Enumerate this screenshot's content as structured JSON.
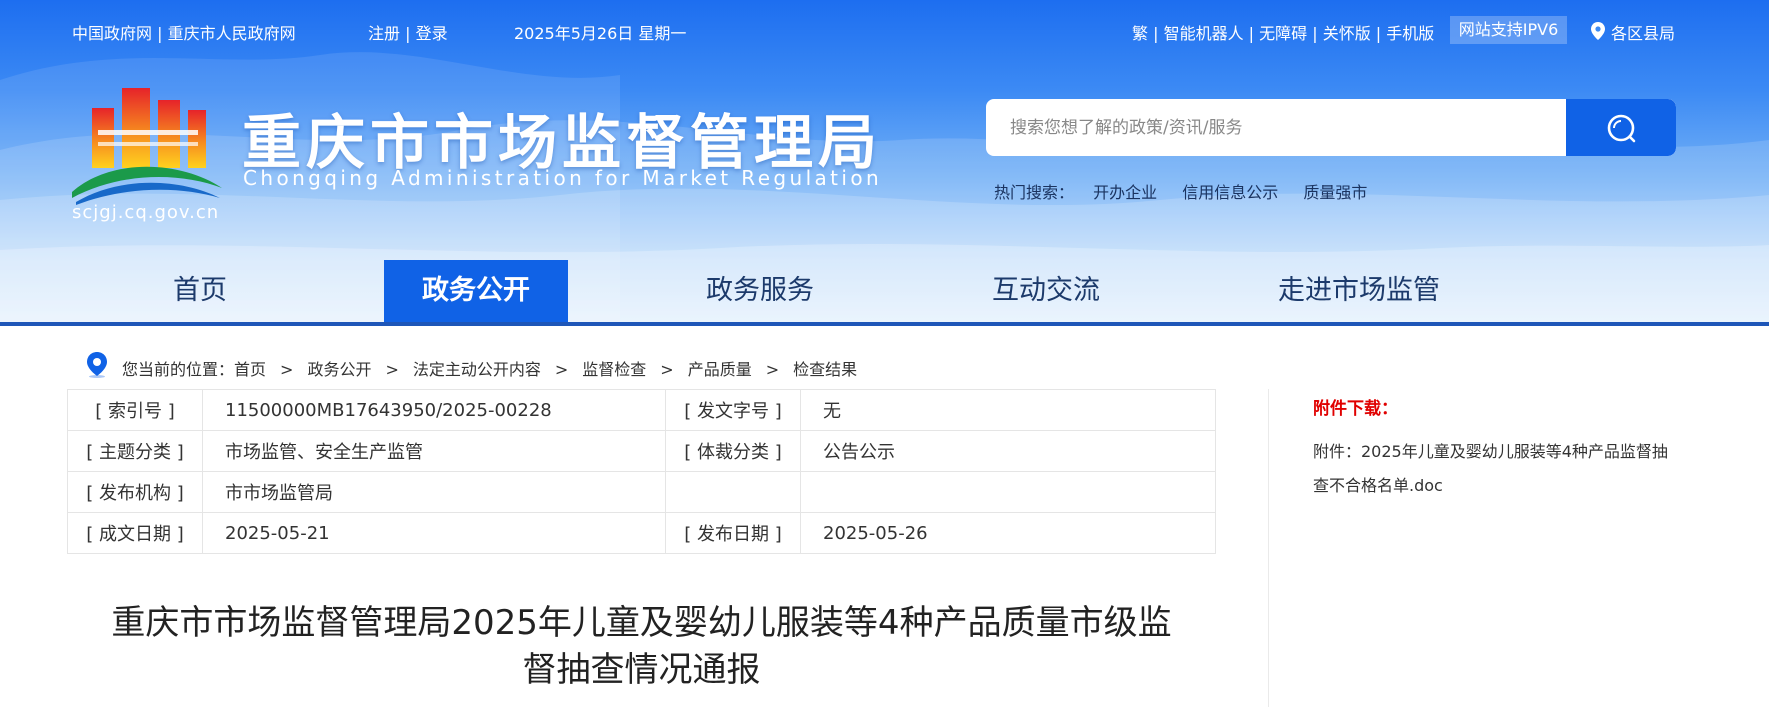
{
  "topbar": {
    "gov_links": "中国政府网 | 重庆市人民政府网",
    "account_links": "注册 | 登录",
    "date": "2025年5月26日 星期一",
    "tools": "繁 | 智能机器人 | 无障碍 | 关怀版 | 手机版",
    "ipv6": "网站支持IPV6",
    "region": "各区县局"
  },
  "branding": {
    "title": "重庆市市场监督管理局",
    "subtitle": "Chongqing  Administration for Market Regulation",
    "domain": "scjgj.cq.gov.cn"
  },
  "search": {
    "placeholder": "搜索您想了解的政策/资讯/服务",
    "hot_label": "热门搜索：",
    "hot_keywords": [
      "开办企业",
      "信用信息公示",
      "质量强市"
    ]
  },
  "nav": {
    "items": [
      "首页",
      "政务公开",
      "政务服务",
      "互动交流",
      "走进市场监管"
    ],
    "active_index": 1
  },
  "breadcrumb": {
    "prefix": "您当前的位置：",
    "items": [
      "首页",
      "政务公开",
      "法定主动公开内容",
      "监督检查",
      "产品质量",
      "检查结果"
    ],
    "separator": ">"
  },
  "meta": {
    "rows": [
      [
        "[ 索引号 ]",
        "11500000MB17643950/2025-00228",
        "[ 发文字号 ]",
        "无"
      ],
      [
        "[ 主题分类 ]",
        "市场监管、安全生产监管",
        "[ 体裁分类 ]",
        "公告公示"
      ],
      [
        "[ 发布机构 ]",
        "市市场监管局",
        "",
        ""
      ],
      [
        "[ 成文日期 ]",
        "2025-05-21",
        "[ 发布日期 ]",
        "2025-05-26"
      ]
    ]
  },
  "document": {
    "title_line1": "重庆市市场监督管理局2025年儿童及婴幼儿服装等4种产品质量市级监",
    "title_line2": "督抽查情况通报"
  },
  "attachment": {
    "label": "附件下载：",
    "file": "附件：2025年儿童及婴幼儿服装等4种产品监督抽查不合格名单.doc"
  },
  "colors": {
    "primary": "#1062e6",
    "active_underline": "#e6121b",
    "attachment_label": "#e00000"
  }
}
